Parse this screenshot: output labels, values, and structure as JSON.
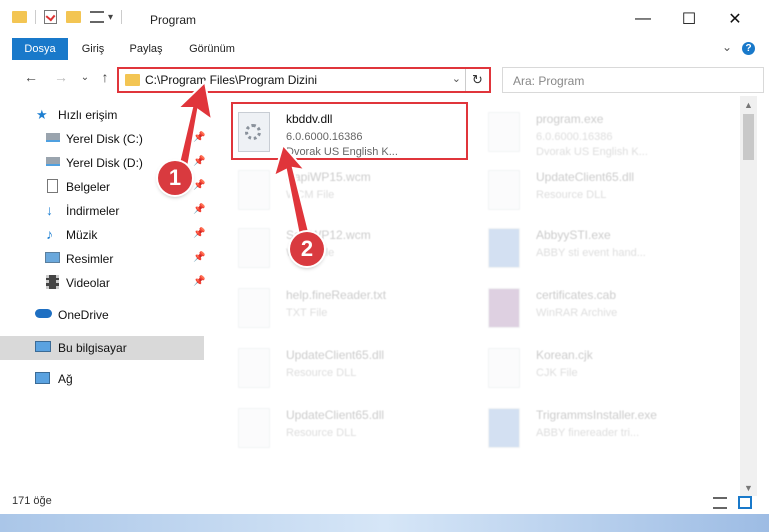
{
  "window": {
    "title": "Program",
    "minimize_glyph": "—",
    "maximize_glyph": "☐",
    "close_glyph": "✕"
  },
  "ribbon": {
    "tabs": [
      "Dosya",
      "Giriş",
      "Paylaş",
      "Görünüm"
    ],
    "active_tab": "Dosya",
    "expand_glyph": "⌄",
    "help_glyph": "?"
  },
  "nav": {
    "address": "C:\\Program Files\\Program Dizini",
    "search_placeholder": "Ara: Program",
    "back_glyph": "←",
    "forward_glyph": "→",
    "recent_glyph": "⌄",
    "up_glyph": "↑",
    "dropdown_glyph": "⌄",
    "refresh_glyph": "↻"
  },
  "sidebar": {
    "items": [
      {
        "label": "Hızlı erişim",
        "icon": "star-icon",
        "pinned": false
      },
      {
        "label": "Yerel Disk (C:)",
        "icon": "drive-icon",
        "pinned": true
      },
      {
        "label": "Yerel Disk (D:)",
        "icon": "drive-icon",
        "pinned": true
      },
      {
        "label": "Belgeler",
        "icon": "documents-icon",
        "pinned": true
      },
      {
        "label": "İndirmeler",
        "icon": "download-icon",
        "pinned": true
      },
      {
        "label": "Müzik",
        "icon": "music-icon",
        "pinned": true
      },
      {
        "label": "Resimler",
        "icon": "pictures-icon",
        "pinned": true
      },
      {
        "label": "Videolar",
        "icon": "video-icon",
        "pinned": true
      },
      {
        "label": "OneDrive",
        "icon": "cloud-icon",
        "pinned": false
      },
      {
        "label": "Bu bilgisayar",
        "icon": "computer-icon",
        "pinned": false
      },
      {
        "label": "Ağ",
        "icon": "network-icon",
        "pinned": false
      }
    ],
    "selected": "Bu bilgisayar"
  },
  "files": [
    {
      "name": "kbddv.dll",
      "line1": "6.0.6000.16386",
      "line2": "Dvorak US English K...",
      "highlighted": true
    },
    {
      "name": "program.exe",
      "line1": "6.0.6000.16386",
      "line2": "Dvorak US English K...",
      "highlighted": false
    },
    {
      "name": "SapiWP15.wcm",
      "line1": "WCM File",
      "line2": "",
      "highlighted": false
    },
    {
      "name": "UpdateClient65.dll",
      "line1": "Resource DLL",
      "line2": "",
      "highlighted": false
    },
    {
      "name": "SapiWP12.wcm",
      "line1": "WCM File",
      "line2": "",
      "highlighted": false
    },
    {
      "name": "AbbyySTI.exe",
      "line1": "ABBY sti event hand...",
      "line2": "",
      "highlighted": false
    },
    {
      "name": "help.fineReader.txt",
      "line1": "TXT File",
      "line2": "",
      "highlighted": false
    },
    {
      "name": "certificates.cab",
      "line1": "WinRAR Archive",
      "line2": "",
      "highlighted": false
    },
    {
      "name": "UpdateClient65.dll",
      "line1": "Resource DLL",
      "line2": "",
      "highlighted": false
    },
    {
      "name": "Korean.cjk",
      "line1": "CJK File",
      "line2": "",
      "highlighted": false
    },
    {
      "name": "UpdateClient65.dll",
      "line1": "Resource DLL",
      "line2": "",
      "highlighted": false
    },
    {
      "name": "TrigrammsInstaller.exe",
      "line1": "ABBY finereader tri...",
      "line2": "",
      "highlighted": false
    }
  ],
  "status": {
    "item_count": "171 öğe"
  },
  "annotations": {
    "marker1": "1",
    "marker2": "2",
    "accent_color": "#e0353b"
  },
  "colors": {
    "ribbon_active": "#1979ca",
    "folder": "#f3c553",
    "selected_bg": "#d9d9d9"
  }
}
